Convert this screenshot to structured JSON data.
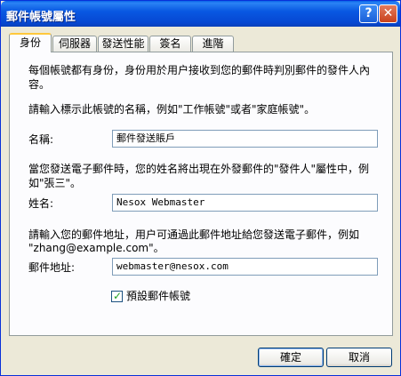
{
  "window": {
    "title": "郵件帳號屬性",
    "help_glyph": "?",
    "close_glyph": "✕"
  },
  "tabs": [
    {
      "label": "身份",
      "active": true
    },
    {
      "label": "伺服器"
    },
    {
      "label": "發送性能"
    },
    {
      "label": "簽名"
    },
    {
      "label": "進階"
    }
  ],
  "identity": {
    "intro_line1": "每個帳號都有身份，身份用於用户接收到您的郵件時判別郵件的發件人內",
    "intro_line2": "容。",
    "name_prompt": "請輸入標示此帳號的名稱，例如\"工作帳號\"或者\"家庭帳號\"。",
    "account_name_label": "名稱:",
    "account_name_value": "郵件發送賬戶",
    "sender_hint_line1": "當您發送電子郵件時，您的姓名將出現在外發郵件的\"發件人\"屬性中，例",
    "sender_hint_line2": "如\"張三\"。",
    "full_name_label": "姓名:",
    "full_name_value": "Nesox Webmaster",
    "email_hint_line1": "請輸入您的郵件地址，用户可通過此郵件地址給您發送電子郵件，例如",
    "email_hint_line2": "\"zhang@example.com\"。",
    "email_label": "郵件地址:",
    "email_value": "webmaster@nesox.com",
    "default_checkbox_label": "預設郵件帳號",
    "default_checked": true
  },
  "buttons": {
    "ok": "確定",
    "cancel": "取消"
  }
}
